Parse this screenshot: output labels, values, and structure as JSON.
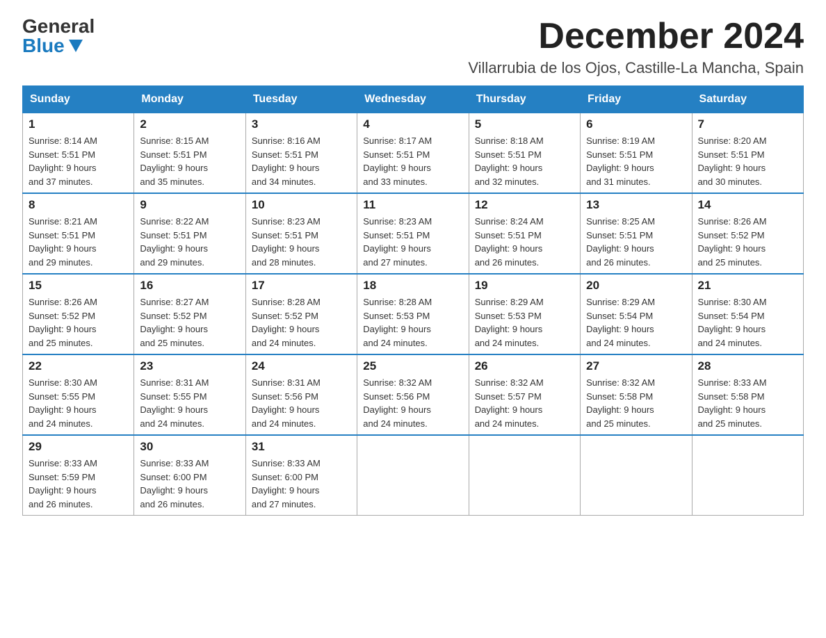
{
  "logo": {
    "general": "General",
    "blue": "Blue"
  },
  "title": "December 2024",
  "location": "Villarrubia de los Ojos, Castille-La Mancha, Spain",
  "weekdays": [
    "Sunday",
    "Monday",
    "Tuesday",
    "Wednesday",
    "Thursday",
    "Friday",
    "Saturday"
  ],
  "weeks": [
    [
      {
        "day": "1",
        "sunrise": "8:14 AM",
        "sunset": "5:51 PM",
        "daylight": "9 hours and 37 minutes."
      },
      {
        "day": "2",
        "sunrise": "8:15 AM",
        "sunset": "5:51 PM",
        "daylight": "9 hours and 35 minutes."
      },
      {
        "day": "3",
        "sunrise": "8:16 AM",
        "sunset": "5:51 PM",
        "daylight": "9 hours and 34 minutes."
      },
      {
        "day": "4",
        "sunrise": "8:17 AM",
        "sunset": "5:51 PM",
        "daylight": "9 hours and 33 minutes."
      },
      {
        "day": "5",
        "sunrise": "8:18 AM",
        "sunset": "5:51 PM",
        "daylight": "9 hours and 32 minutes."
      },
      {
        "day": "6",
        "sunrise": "8:19 AM",
        "sunset": "5:51 PM",
        "daylight": "9 hours and 31 minutes."
      },
      {
        "day": "7",
        "sunrise": "8:20 AM",
        "sunset": "5:51 PM",
        "daylight": "9 hours and 30 minutes."
      }
    ],
    [
      {
        "day": "8",
        "sunrise": "8:21 AM",
        "sunset": "5:51 PM",
        "daylight": "9 hours and 29 minutes."
      },
      {
        "day": "9",
        "sunrise": "8:22 AM",
        "sunset": "5:51 PM",
        "daylight": "9 hours and 29 minutes."
      },
      {
        "day": "10",
        "sunrise": "8:23 AM",
        "sunset": "5:51 PM",
        "daylight": "9 hours and 28 minutes."
      },
      {
        "day": "11",
        "sunrise": "8:23 AM",
        "sunset": "5:51 PM",
        "daylight": "9 hours and 27 minutes."
      },
      {
        "day": "12",
        "sunrise": "8:24 AM",
        "sunset": "5:51 PM",
        "daylight": "9 hours and 26 minutes."
      },
      {
        "day": "13",
        "sunrise": "8:25 AM",
        "sunset": "5:51 PM",
        "daylight": "9 hours and 26 minutes."
      },
      {
        "day": "14",
        "sunrise": "8:26 AM",
        "sunset": "5:52 PM",
        "daylight": "9 hours and 25 minutes."
      }
    ],
    [
      {
        "day": "15",
        "sunrise": "8:26 AM",
        "sunset": "5:52 PM",
        "daylight": "9 hours and 25 minutes."
      },
      {
        "day": "16",
        "sunrise": "8:27 AM",
        "sunset": "5:52 PM",
        "daylight": "9 hours and 25 minutes."
      },
      {
        "day": "17",
        "sunrise": "8:28 AM",
        "sunset": "5:52 PM",
        "daylight": "9 hours and 24 minutes."
      },
      {
        "day": "18",
        "sunrise": "8:28 AM",
        "sunset": "5:53 PM",
        "daylight": "9 hours and 24 minutes."
      },
      {
        "day": "19",
        "sunrise": "8:29 AM",
        "sunset": "5:53 PM",
        "daylight": "9 hours and 24 minutes."
      },
      {
        "day": "20",
        "sunrise": "8:29 AM",
        "sunset": "5:54 PM",
        "daylight": "9 hours and 24 minutes."
      },
      {
        "day": "21",
        "sunrise": "8:30 AM",
        "sunset": "5:54 PM",
        "daylight": "9 hours and 24 minutes."
      }
    ],
    [
      {
        "day": "22",
        "sunrise": "8:30 AM",
        "sunset": "5:55 PM",
        "daylight": "9 hours and 24 minutes."
      },
      {
        "day": "23",
        "sunrise": "8:31 AM",
        "sunset": "5:55 PM",
        "daylight": "9 hours and 24 minutes."
      },
      {
        "day": "24",
        "sunrise": "8:31 AM",
        "sunset": "5:56 PM",
        "daylight": "9 hours and 24 minutes."
      },
      {
        "day": "25",
        "sunrise": "8:32 AM",
        "sunset": "5:56 PM",
        "daylight": "9 hours and 24 minutes."
      },
      {
        "day": "26",
        "sunrise": "8:32 AM",
        "sunset": "5:57 PM",
        "daylight": "9 hours and 24 minutes."
      },
      {
        "day": "27",
        "sunrise": "8:32 AM",
        "sunset": "5:58 PM",
        "daylight": "9 hours and 25 minutes."
      },
      {
        "day": "28",
        "sunrise": "8:33 AM",
        "sunset": "5:58 PM",
        "daylight": "9 hours and 25 minutes."
      }
    ],
    [
      {
        "day": "29",
        "sunrise": "8:33 AM",
        "sunset": "5:59 PM",
        "daylight": "9 hours and 26 minutes."
      },
      {
        "day": "30",
        "sunrise": "8:33 AM",
        "sunset": "6:00 PM",
        "daylight": "9 hours and 26 minutes."
      },
      {
        "day": "31",
        "sunrise": "8:33 AM",
        "sunset": "6:00 PM",
        "daylight": "9 hours and 27 minutes."
      },
      null,
      null,
      null,
      null
    ]
  ],
  "labels": {
    "sunrise": "Sunrise:",
    "sunset": "Sunset:",
    "daylight": "Daylight:"
  }
}
